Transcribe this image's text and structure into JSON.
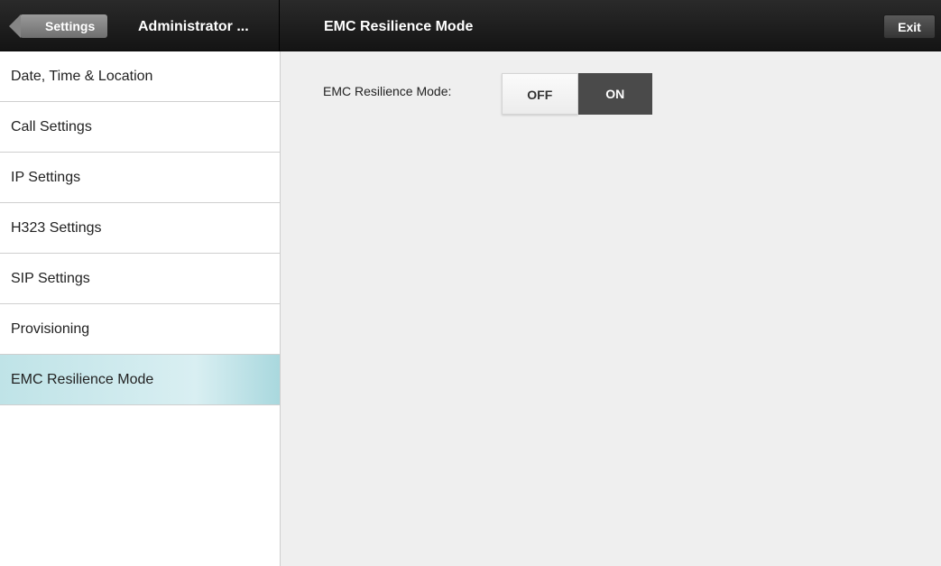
{
  "header": {
    "back_label": "Settings",
    "section_title": "Administrator ...",
    "page_title": "EMC Resilience Mode",
    "exit_label": "Exit"
  },
  "sidebar": {
    "items": [
      {
        "label": "Date, Time & Location"
      },
      {
        "label": "Call Settings"
      },
      {
        "label": "IP Settings"
      },
      {
        "label": "H323 Settings"
      },
      {
        "label": "SIP Settings"
      },
      {
        "label": "Provisioning"
      },
      {
        "label": "EMC Resilience Mode",
        "active": true
      }
    ]
  },
  "main": {
    "field_label": "EMC Resilience Mode:",
    "toggle": {
      "off_label": "OFF",
      "on_label": "ON",
      "selected": "OFF"
    }
  },
  "colors": {
    "topbar": "#1e1e1e",
    "active_item": "#c8e8ec",
    "toggle_on": "#4a4a4a"
  }
}
